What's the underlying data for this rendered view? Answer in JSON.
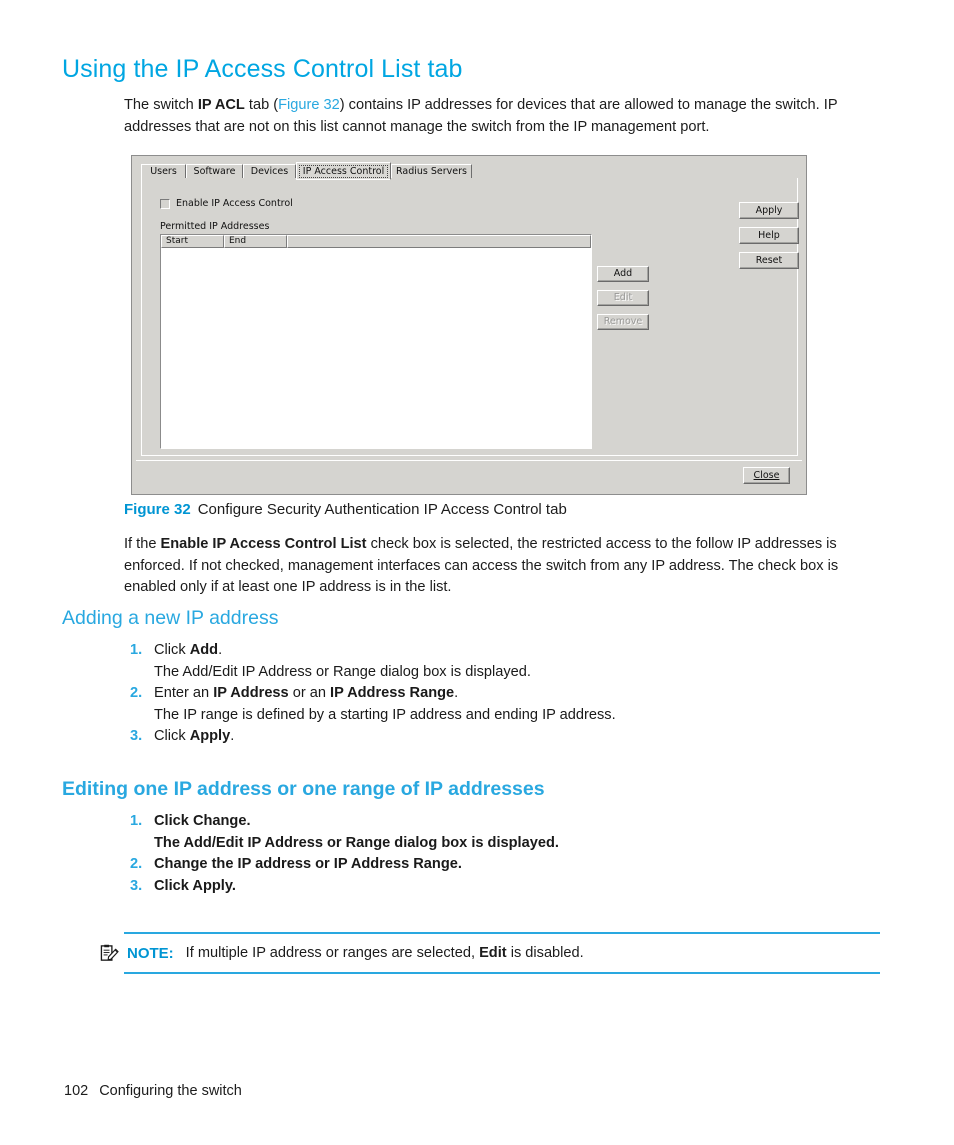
{
  "page": {
    "heading": "Using the IP Access Control List tab",
    "intro": {
      "p1": "The switch ",
      "bold1": "IP ACL",
      "p2": " tab (",
      "link": "Figure 32",
      "p3": ") contains IP addresses for devices that are allowed to manage the switch. IP addresses that are not on this list cannot manage the switch from the IP management port."
    },
    "figure_caption": {
      "number": "Figure 32",
      "text": "Configure Security Authentication IP Access Control tab"
    },
    "after_figure": {
      "p1": "If the ",
      "bold1": "Enable IP Access Control List",
      "p2": " check box is selected, the restricted access to the follow IP addresses is enforced. If not checked, management interfaces can access the switch from any IP address. The check box is enabled only if at least one IP address is in the list."
    },
    "section_add": {
      "heading": "Adding a new IP address",
      "steps": [
        {
          "num": "1.",
          "pre": "Click ",
          "bold": "Add",
          "post": ".",
          "sub": "The Add/Edit IP Address or Range dialog box is displayed."
        },
        {
          "num": "2.",
          "pre": "Enter an ",
          "bold": "IP Address",
          "mid": " or an ",
          "bold2": "IP Address Range",
          "post": ".",
          "sub": "The IP range is defined by a starting IP address and ending IP address."
        },
        {
          "num": "3.",
          "pre": "Click ",
          "bold": "Apply",
          "post": "."
        }
      ]
    },
    "section_edit": {
      "heading": "Editing one IP address or one range of IP addresses",
      "steps": [
        {
          "num": "1.",
          "pre": "Click ",
          "bold": "Change",
          "post": ".",
          "sub": "The Add/Edit IP Address or Range dialog box is displayed."
        },
        {
          "num": "2.",
          "pre": "Change the ",
          "bold": "IP address",
          "mid": " or ",
          "bold2": "IP Address Range",
          "post": "."
        },
        {
          "num": "3.",
          "pre": "Click ",
          "bold": "Apply",
          "post": "."
        }
      ]
    },
    "note": {
      "icon": "note-clipboard-icon",
      "label": "NOTE:",
      "pre": "If multiple IP address or ranges are selected, ",
      "bold": "Edit",
      "post": " is disabled."
    },
    "footer": {
      "page_number": "102",
      "chapter": "Configuring the switch"
    },
    "colors": {
      "accent_blue": "#29a8e0",
      "heading_blue": "#00a6e2",
      "figure_number_blue": "#0095d3",
      "dialog_face": "#d5d4d0",
      "text": "#1c1c1c"
    }
  },
  "figure": {
    "tabs": [
      {
        "label": "Users",
        "selected": false
      },
      {
        "label": "Software",
        "selected": false
      },
      {
        "label": "Devices",
        "selected": false
      },
      {
        "label": "IP Access Control",
        "selected": true
      },
      {
        "label": "Radius Servers",
        "selected": false
      }
    ],
    "checkbox": {
      "label": "Enable IP Access Control",
      "checked": false
    },
    "list": {
      "label": "Permitted IP Addresses",
      "columns": [
        "Start",
        "End"
      ],
      "rows": []
    },
    "list_buttons": [
      {
        "label": "Add",
        "enabled": true
      },
      {
        "label": "Edit",
        "enabled": false
      },
      {
        "label": "Remove",
        "enabled": false
      }
    ],
    "side_buttons": [
      {
        "label": "Apply",
        "enabled": true
      },
      {
        "label": "Help",
        "enabled": true
      },
      {
        "label": "Reset",
        "enabled": true
      }
    ],
    "close_button": {
      "label": "Close",
      "mnemonic": "C"
    }
  }
}
